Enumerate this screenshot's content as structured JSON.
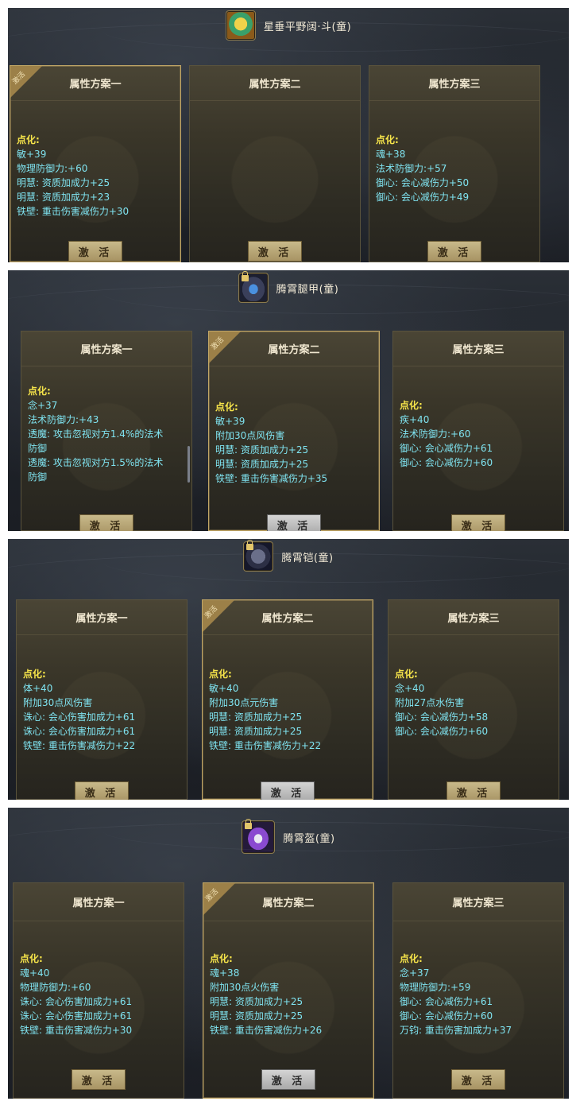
{
  "panels": [
    {
      "item": {
        "name": "星垂平野阔·斗(童)",
        "icon": "emblem-icon"
      },
      "cards": [
        {
          "title": "属性方案一",
          "badge": "激活",
          "head": "点化:",
          "lines": [
            "敏+39",
            "物理防御力:+60",
            "明慧: 资质加成力+25",
            "明慧: 资质加成力+23",
            "铁壁: 重击伤害减伤力+30"
          ],
          "button": "激 活"
        },
        {
          "title": "属性方案二",
          "head": "",
          "lines": [],
          "button": "激 活"
        },
        {
          "title": "属性方案三",
          "head": "点化:",
          "lines": [
            "魂+38",
            "法术防御力:+57",
            "御心: 会心减伤力+50",
            "御心: 会心减伤力+49"
          ],
          "button": "激 活"
        }
      ]
    },
    {
      "item": {
        "name": "腾霄腿甲(童)",
        "icon": "leg-armor-icon"
      },
      "cards": [
        {
          "title": "属性方案一",
          "head": "点化:",
          "lines": [
            "念+37",
            "法术防御力:+43",
            "透魔: 攻击忽视对方1.4%的法术",
            "防御",
            "透魔: 攻击忽视对方1.5%的法术",
            "防御"
          ],
          "button": "激 活"
        },
        {
          "title": "属性方案二",
          "badge": "激活",
          "head": "点化:",
          "lines": [
            "敏+39",
            "附加30点风伤害",
            "明慧: 资质加成力+25",
            "明慧: 资质加成力+25",
            "铁壁: 重击伤害减伤力+35"
          ],
          "button": "激 活"
        },
        {
          "title": "属性方案三",
          "head": "点化:",
          "lines": [
            "疾+40",
            "法术防御力:+60",
            "御心: 会心减伤力+61",
            "御心: 会心减伤力+60"
          ],
          "button": "激 活"
        }
      ]
    },
    {
      "item": {
        "name": "腾霄铠(童)",
        "icon": "armor-icon"
      },
      "cards": [
        {
          "title": "属性方案一",
          "head": "点化:",
          "lines": [
            "体+40",
            "附加30点风伤害",
            "诛心: 会心伤害加成力+61",
            "诛心: 会心伤害加成力+61",
            "铁壁: 重击伤害减伤力+22"
          ],
          "button": "激 活"
        },
        {
          "title": "属性方案二",
          "badge": "激活",
          "head": "点化:",
          "lines": [
            "敏+40",
            "附加30点元伤害",
            "明慧: 资质加成力+25",
            "明慧: 资质加成力+25",
            "铁壁: 重击伤害减伤力+22"
          ],
          "button": "激 活"
        },
        {
          "title": "属性方案三",
          "head": "点化:",
          "lines": [
            "念+40",
            "附加27点水伤害",
            "御心: 会心减伤力+58",
            "御心: 会心减伤力+60"
          ],
          "button": "激 活"
        }
      ]
    },
    {
      "item": {
        "name": "腾霄盔(童)",
        "icon": "helmet-icon"
      },
      "cards": [
        {
          "title": "属性方案一",
          "head": "点化:",
          "lines": [
            "魂+40",
            "物理防御力:+60",
            "诛心: 会心伤害加成力+61",
            "诛心: 会心伤害加成力+61",
            "铁壁: 重击伤害减伤力+30"
          ],
          "button": "激 活"
        },
        {
          "title": "属性方案二",
          "badge": "激活",
          "head": "点化:",
          "lines": [
            "魂+38",
            "附加30点火伤害",
            "明慧: 资质加成力+25",
            "明慧: 资质加成力+25",
            "铁壁: 重击伤害减伤力+26"
          ],
          "button": "激 活"
        },
        {
          "title": "属性方案三",
          "head": "点化:",
          "lines": [
            "念+37",
            "物理防御力:+59",
            "御心: 会心减伤力+61",
            "御心: 会心减伤力+60",
            "万钧: 重击伤害加成力+37"
          ],
          "button": "激 活"
        }
      ]
    }
  ]
}
